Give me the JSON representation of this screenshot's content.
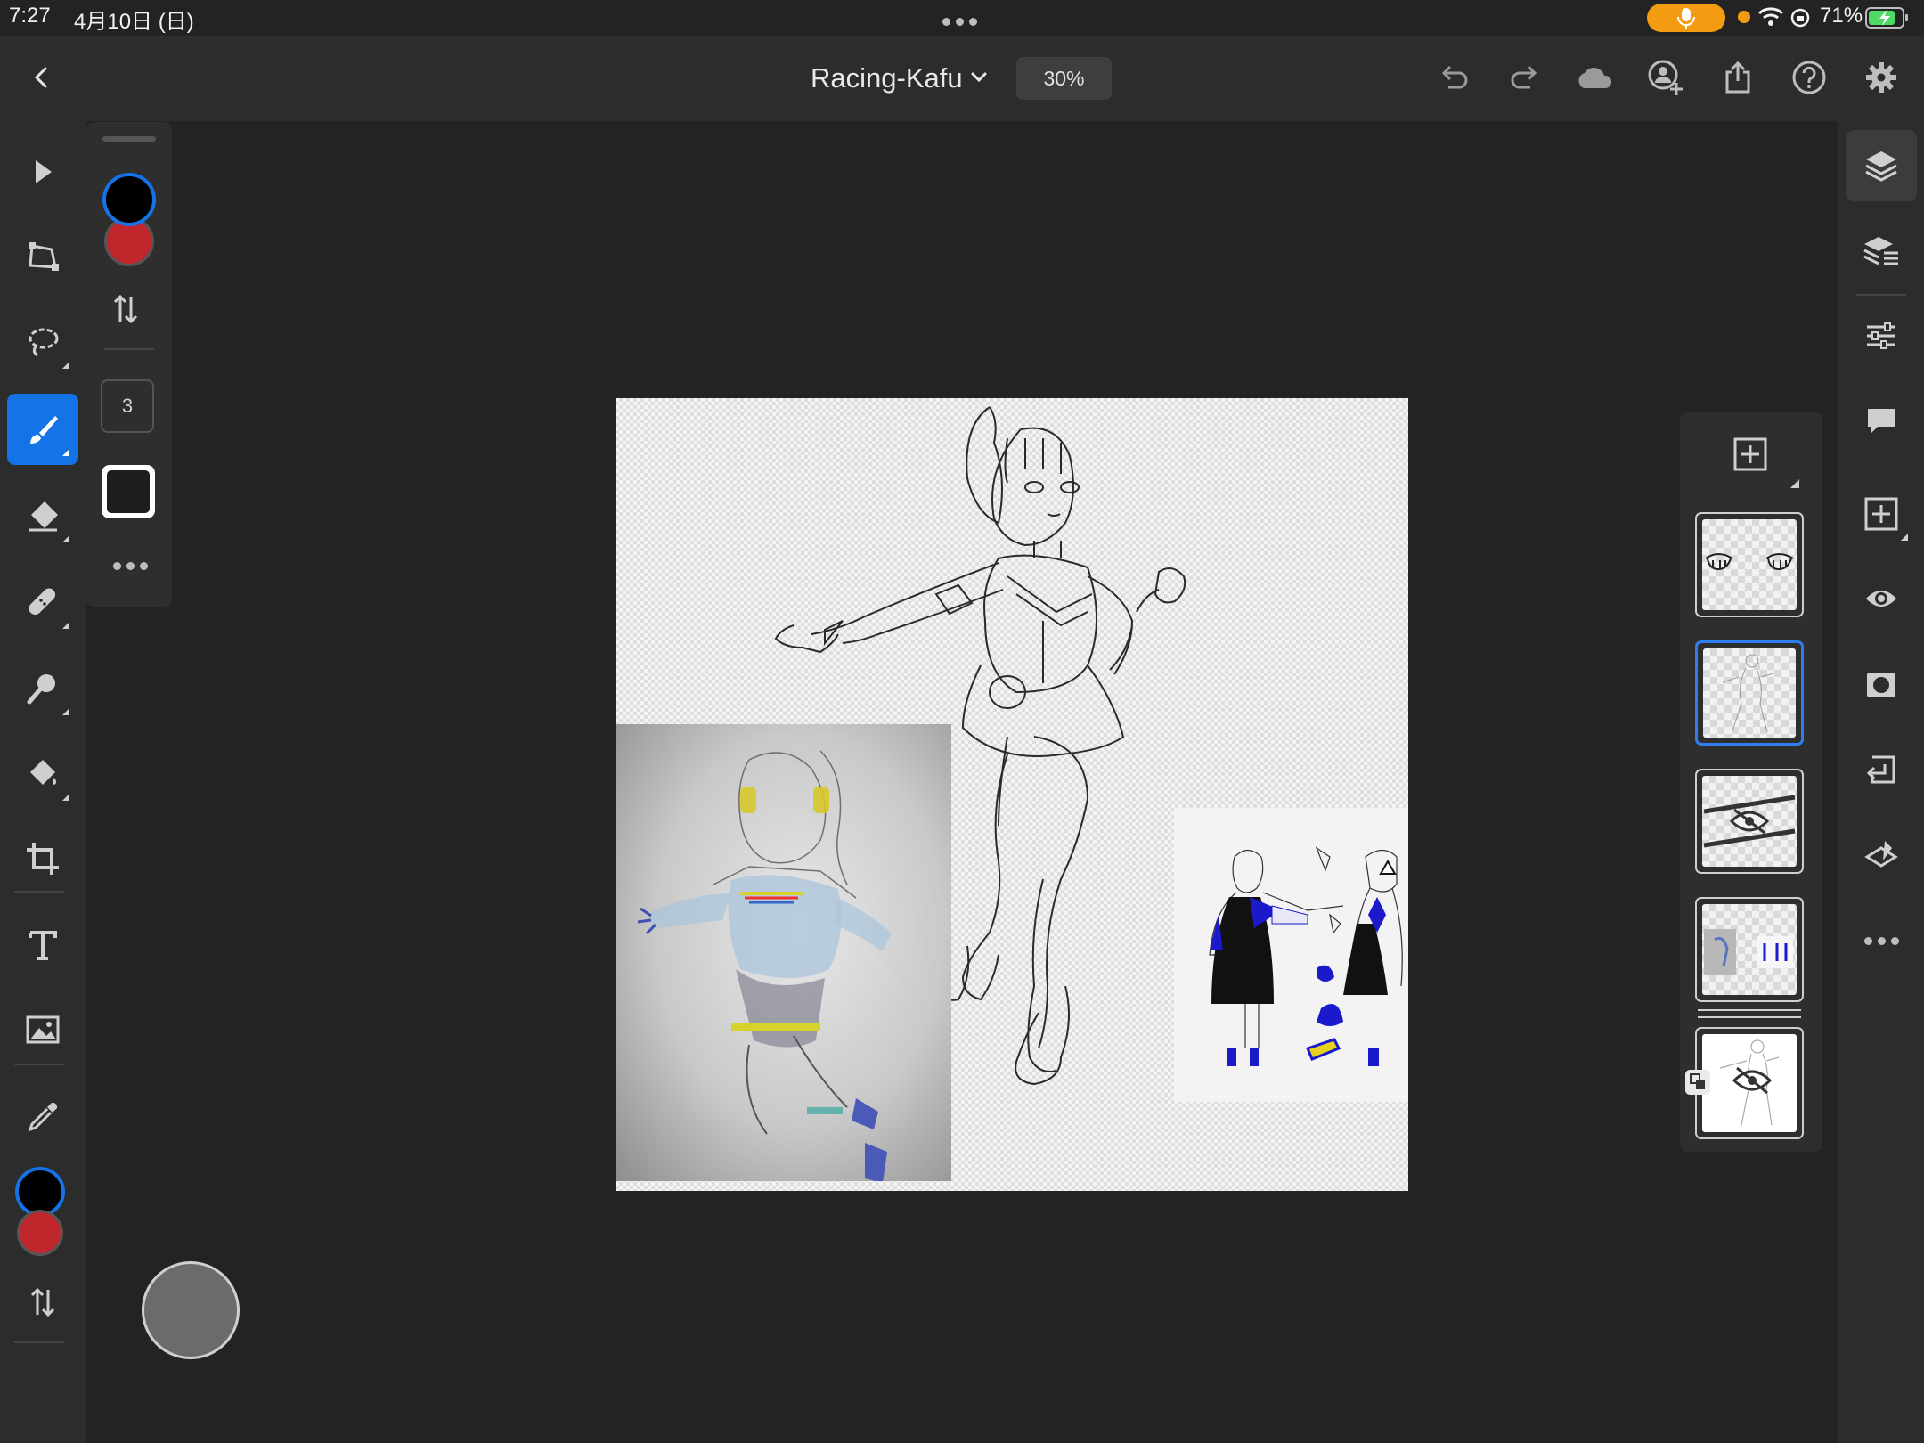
{
  "status_bar": {
    "time": "7:27",
    "date": "4月10日 (日)",
    "battery": "71%",
    "icons": [
      "microphone-icon",
      "dot-icon",
      "wifi-icon",
      "rotation-lock-icon",
      "battery-charging-icon"
    ]
  },
  "top_bar": {
    "document_title": "Racing-Kafu",
    "zoom": "30%",
    "icons": [
      "back-icon",
      "chevron-down-icon",
      "undo-icon",
      "redo-icon",
      "cloud-icon",
      "invite-user-icon",
      "share-icon",
      "help-icon",
      "settings-gear-icon"
    ]
  },
  "left_toolbar": {
    "tools": [
      "select-arrow-icon",
      "transform-icon",
      "lasso-icon",
      "brush-icon",
      "eraser-icon",
      "healing-icon",
      "smudge-icon",
      "fill-icon",
      "crop-icon",
      "text-icon",
      "image-icon",
      "eyedropper-icon"
    ],
    "active_tool": "brush-icon",
    "foreground_color": "#000000",
    "background_color": "#c0272d"
  },
  "tool_options": {
    "brush_size": "3",
    "foreground_color": "#000000",
    "background_color": "#c0272d"
  },
  "canvas": {
    "layers_visible": [
      "line-art-sketch",
      "photo-sketch",
      "character-reference-sheet"
    ]
  },
  "layers_panel": {
    "layers": [
      {
        "name": "eyes-layer",
        "selected": false,
        "hidden": false
      },
      {
        "name": "lineart-layer",
        "selected": true,
        "hidden": false
      },
      {
        "name": "stripes-layer",
        "selected": false,
        "hidden": true
      },
      {
        "name": "references-layer",
        "selected": false,
        "hidden": false
      },
      {
        "name": "base-figure-layer",
        "selected": false,
        "hidden": true
      }
    ]
  },
  "right_toolbar": {
    "icons": [
      "layers-icon",
      "layer-properties-icon",
      "adjustments-icon",
      "comments-icon",
      "add-layer-icon",
      "visibility-eye-icon",
      "mask-icon",
      "layer-import-icon",
      "clear-layer-icon",
      "more-icon"
    ]
  },
  "colors": {
    "accent": "#1473e6",
    "selected_layer_border": "#2f7ef0",
    "mic_pill": "#f39c12",
    "battery": "#4cd964"
  }
}
